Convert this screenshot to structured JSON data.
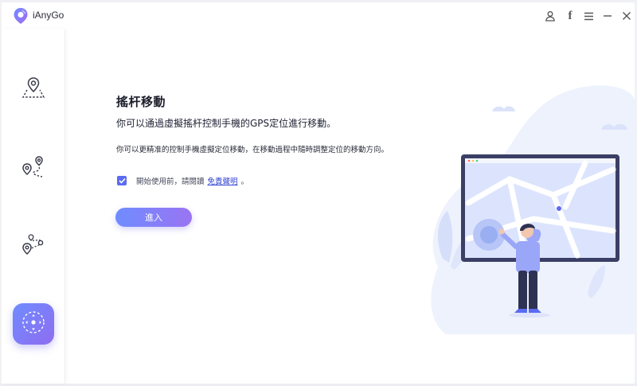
{
  "app": {
    "title": "iAnyGo"
  },
  "window_controls": [
    "user-icon",
    "facebook-icon",
    "menu-icon",
    "minimize-icon",
    "close-icon"
  ],
  "sidebar": {
    "items": [
      {
        "name": "location-change",
        "icon": "pin-map-icon"
      },
      {
        "name": "multi-spot",
        "icon": "multi-pin-route-icon"
      },
      {
        "name": "two-spot",
        "icon": "pin-path-icon"
      },
      {
        "name": "joystick",
        "icon": "joystick-icon",
        "active": true
      }
    ]
  },
  "main": {
    "heading": "搖杆移動",
    "subtitle": "你可以通過虛擬搖杆控制手機的GPS定位進行移動。",
    "description": "你可以更精准的控制手機虛擬定位移動，在移動過程中隨時調整定位的移動方向。",
    "agree": {
      "checked": true,
      "text": "開始使用前，請閱讀",
      "link": "免責聲明",
      "end": "。"
    },
    "enter_button": "進入"
  },
  "colors": {
    "accent_start": "#6f8cff",
    "accent_end": "#9a74f2",
    "link": "#2f3fd0",
    "illustration_bg": "#eef2fd"
  }
}
